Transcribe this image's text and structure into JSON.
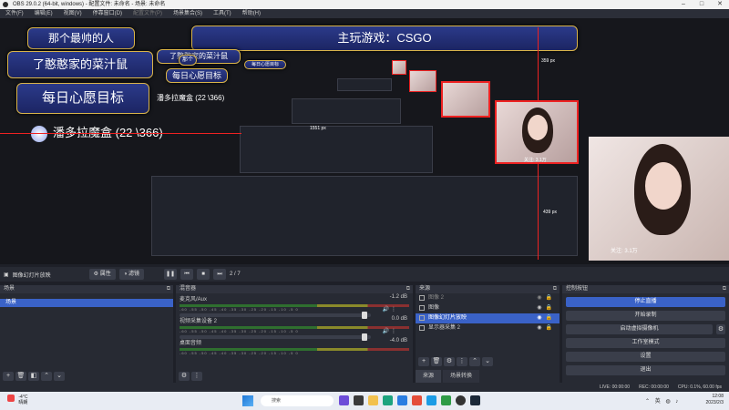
{
  "window": {
    "title": "OBS 29.0.2 (64-bit, windows) - 配置文件: 未命名 - 场景: 未命名"
  },
  "menu": [
    "文件(F)",
    "编辑(E)",
    "视图(V)",
    "停靠窗口(D)",
    "配置文件(P)",
    "场景集合(S)",
    "工具(T)",
    "帮助(H)"
  ],
  "preview": {
    "banner_title": "主玩游戏：CSGO",
    "banner_1": "那个最帅的人",
    "banner_2": "了憨憨家的菜汁鼠",
    "banner_3": "每日心愿目标",
    "banner_4": "了憨憨家的菜汁鼠",
    "banner_5": "每日心愿目标",
    "banner_6": "那个",
    "banner_7": "每日心愿目标",
    "line_big": "潘多拉魔盒 (22 \\366)",
    "line_small": "潘多拉魔盒 (22 \\366)",
    "measure_1": "359 px",
    "measure_2": "1551 px",
    "measure_3": "439 px",
    "nested_follower": "关注: 3.1万",
    "follower": "关注: 3.1万"
  },
  "toolbar": {
    "source_name": "图像幻灯片放映",
    "properties": "属性",
    "filters": "滤镜",
    "counter": "2 / 7"
  },
  "scenes": {
    "title": "场景",
    "items": [
      "场景"
    ]
  },
  "mixer": {
    "title": "混音器",
    "ticks": "-60 -55 -50 -45 -40 -35 -30 -25 -20 -15 -10 -5 0",
    "channels": [
      {
        "name": "麦克风/Aux",
        "db": "-1.2 dB"
      },
      {
        "name": "视频采集设备 2",
        "db": "0.0 dB"
      },
      {
        "name": "桌面音频",
        "db": "-4.0 dB"
      }
    ]
  },
  "sources": {
    "title": "来源",
    "items": [
      "图像 2",
      "图像",
      "图像幻灯片放映",
      "显示器采集 2"
    ],
    "tab_active": "来源",
    "tab_other": "场景转换"
  },
  "controls": {
    "title": "控制按钮",
    "stop_stream": "停止直播",
    "start_record": "开始录制",
    "virtual_cam": "启动虚拟摄像机",
    "studio_mode": "工作室模式",
    "settings": "设置",
    "exit": "退出"
  },
  "status": {
    "live": "LIVE: 00:00:00",
    "rec": "REC: 00:00:00",
    "cpu": "CPU: 0.1%, 60.00 fps"
  },
  "taskbar": {
    "weather_temp": "-4°C",
    "weather_desc": "晴朗",
    "search": "搜索",
    "time": "12:08",
    "date": "2023/2/3"
  },
  "colors": {
    "accent": "#3a62c7",
    "guide": "#e22222",
    "banner_border": "#d9b44a"
  }
}
